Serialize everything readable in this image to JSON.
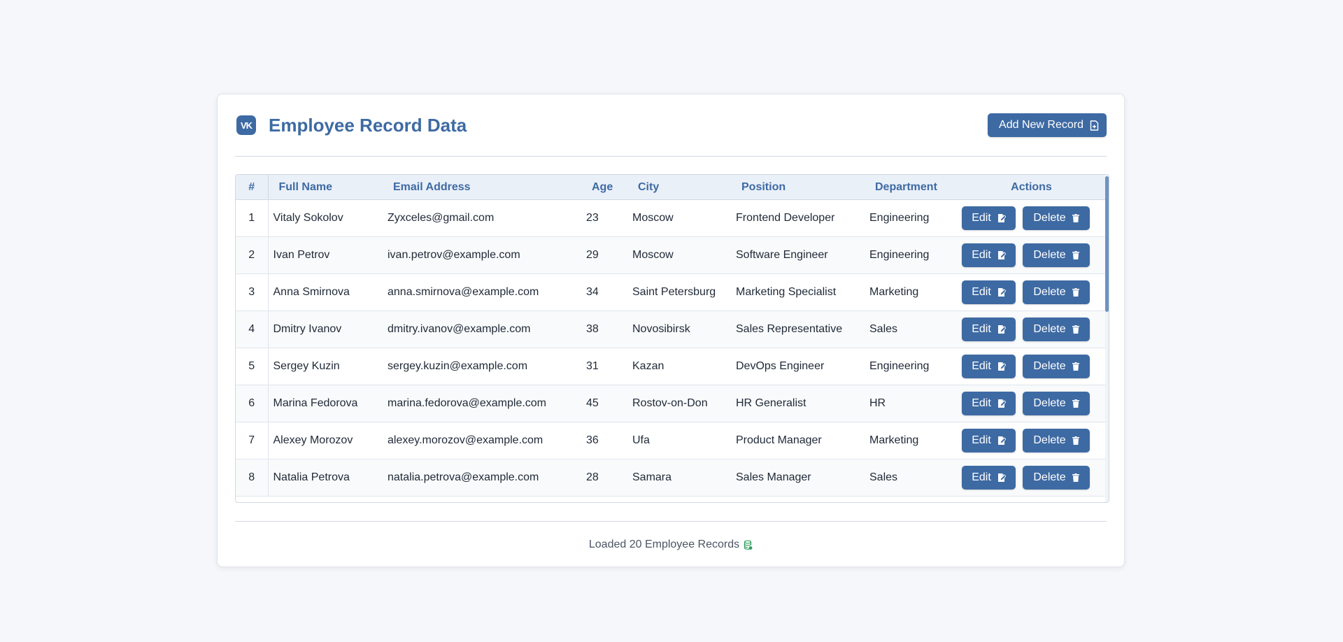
{
  "header": {
    "logo_text": "VK",
    "title": "Employee Record Data",
    "add_button_label": "Add New Record"
  },
  "table": {
    "columns": [
      "#",
      "Full Name",
      "Email Address",
      "Age",
      "City",
      "Position",
      "Department",
      "Actions"
    ],
    "rows": [
      {
        "num": "1",
        "name": "Vitaly Sokolov",
        "email": "Zyxceles@gmail.com",
        "age": "23",
        "city": "Moscow",
        "position": "Frontend Developer",
        "department": "Engineering"
      },
      {
        "num": "2",
        "name": "Ivan Petrov",
        "email": "ivan.petrov@example.com",
        "age": "29",
        "city": "Moscow",
        "position": "Software Engineer",
        "department": "Engineering"
      },
      {
        "num": "3",
        "name": "Anna Smirnova",
        "email": "anna.smirnova@example.com",
        "age": "34",
        "city": "Saint Petersburg",
        "position": "Marketing Specialist",
        "department": "Marketing"
      },
      {
        "num": "4",
        "name": "Dmitry Ivanov",
        "email": "dmitry.ivanov@example.com",
        "age": "38",
        "city": "Novosibirsk",
        "position": "Sales Representative",
        "department": "Sales"
      },
      {
        "num": "5",
        "name": "Sergey Kuzin",
        "email": "sergey.kuzin@example.com",
        "age": "31",
        "city": "Kazan",
        "position": "DevOps Engineer",
        "department": "Engineering"
      },
      {
        "num": "6",
        "name": "Marina Fedorova",
        "email": "marina.fedorova@example.com",
        "age": "45",
        "city": "Rostov-on-Don",
        "position": "HR Generalist",
        "department": "HR"
      },
      {
        "num": "7",
        "name": "Alexey Morozov",
        "email": "alexey.morozov@example.com",
        "age": "36",
        "city": "Ufa",
        "position": "Product Manager",
        "department": "Marketing"
      },
      {
        "num": "8",
        "name": "Natalia Petrova",
        "email": "natalia.petrova@example.com",
        "age": "28",
        "city": "Samara",
        "position": "Sales Manager",
        "department": "Sales"
      }
    ],
    "edit_label": "Edit",
    "delete_label": "Delete"
  },
  "footer": {
    "status_text": "Loaded 20 Employee Records"
  },
  "colors": {
    "accent": "#3e6aa3",
    "header_bg": "#eaf0f8",
    "footer_icon": "#2e9e5b"
  },
  "icons": {
    "logo": "vk-logo-icon",
    "add": "file-plus-icon",
    "edit": "file-edit-icon",
    "delete": "trash-icon",
    "footer": "database-icon"
  }
}
